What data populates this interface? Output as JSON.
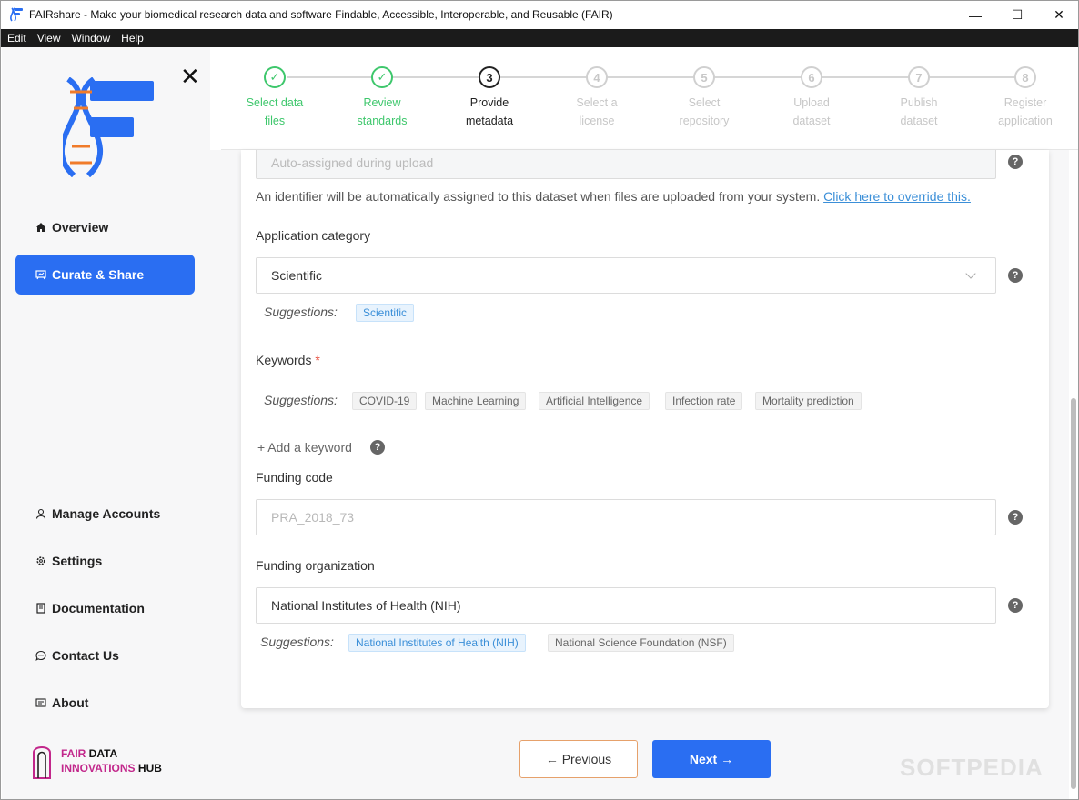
{
  "window": {
    "title": "FAIRshare - Make your biomedical research data and software Findable, Accessible, Interoperable, and Reusable (FAIR)",
    "minimize": "—",
    "maximize": "☐",
    "close": "✕"
  },
  "menu": [
    "Edit",
    "View",
    "Window",
    "Help"
  ],
  "sidebar": {
    "close_icon": "✕",
    "nav_top": [
      {
        "label": "Overview",
        "icon": "home-icon",
        "active": false
      },
      {
        "label": "Curate & Share",
        "icon": "curate-icon",
        "active": true
      }
    ],
    "nav_bottom": [
      {
        "label": "Manage Accounts",
        "icon": "user-icon"
      },
      {
        "label": "Settings",
        "icon": "gear-icon"
      },
      {
        "label": "Documentation",
        "icon": "book-icon"
      },
      {
        "label": "Contact Us",
        "icon": "chat-icon"
      },
      {
        "label": "About",
        "icon": "info-card-icon"
      }
    ],
    "hub": {
      "line1_a": "FAIR",
      "line1_b": " DATA",
      "line2_a": "INNOVATIONS",
      "line2_b": " HUB"
    }
  },
  "stepper": [
    {
      "num": "✓",
      "line1": "Select data",
      "line2": "files",
      "state": "done"
    },
    {
      "num": "✓",
      "line1": "Review",
      "line2": "standards",
      "state": "done"
    },
    {
      "num": "3",
      "line1": "Provide",
      "line2": "metadata",
      "state": "active"
    },
    {
      "num": "4",
      "line1": "Select a",
      "line2": "license",
      "state": "pending"
    },
    {
      "num": "5",
      "line1": "Select",
      "line2": "repository",
      "state": "pending"
    },
    {
      "num": "6",
      "line1": "Upload",
      "line2": "dataset",
      "state": "pending"
    },
    {
      "num": "7",
      "line1": "Publish",
      "line2": "dataset",
      "state": "pending"
    },
    {
      "num": "8",
      "line1": "Register",
      "line2": "application",
      "state": "pending"
    }
  ],
  "form": {
    "identifier": {
      "value": "Auto-assigned during upload",
      "info": "An identifier will be automatically assigned to this dataset when files are uploaded from your system. ",
      "override_link": "Click here to override this."
    },
    "app_category": {
      "label": "Application category",
      "value": "Scientific",
      "suggestions_label": "Suggestions:",
      "suggestions": [
        "Scientific"
      ]
    },
    "keywords": {
      "label": "Keywords",
      "required_mark": "*",
      "suggestions_label": "Suggestions:",
      "suggestions": [
        "COVID-19",
        "Machine Learning",
        "Artificial Intelligence",
        "Infection rate",
        "Mortality prediction"
      ],
      "add_label": "+ Add a keyword"
    },
    "funding_code": {
      "label": "Funding code",
      "placeholder": "PRA_2018_73"
    },
    "funding_org": {
      "label": "Funding organization",
      "value": "National Institutes of Health (NIH)",
      "suggestions_label": "Suggestions:",
      "suggestions": [
        "National Institutes of Health (NIH)",
        "National Science Foundation (NSF)"
      ]
    },
    "help_glyph": "?"
  },
  "buttons": {
    "previous": "← Previous",
    "next": "Next →"
  },
  "watermark": "SOFTPEDIA",
  "colors": {
    "accent": "#2a6ef2",
    "done": "#3ec76c",
    "link": "#3b8fd8",
    "hub_pink": "#c2278b"
  }
}
